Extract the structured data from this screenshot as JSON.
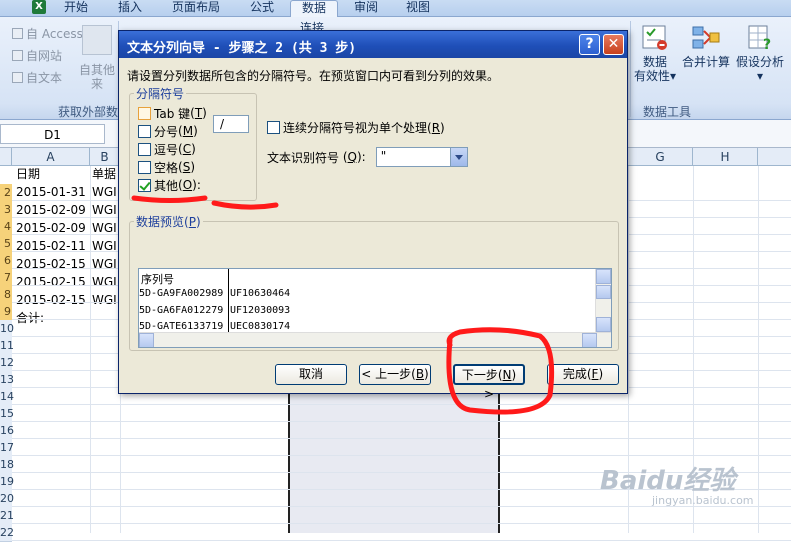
{
  "ribbon": {
    "tabs": [
      "开始",
      "插入",
      "页面布局",
      "公式",
      "数据",
      "审阅",
      "视图"
    ],
    "active_tab": "数据",
    "get_external": [
      "自 Access",
      "自网站",
      "自文本"
    ],
    "other_sources": "自其他来",
    "get_external_group": "获取外部数",
    "connections_partial": "连接",
    "data_tools_items": [
      "数据",
      "合并计算",
      "假设分析"
    ],
    "validity": "有效性",
    "validity_arrow": "▾",
    "whatif_arrow": "▾",
    "data_tools_group": "数据工具"
  },
  "formula_bar": {
    "name_box": "D1"
  },
  "grid": {
    "columns": [
      "A",
      "B",
      "G",
      "H"
    ],
    "rows": [
      "2",
      "3",
      "4",
      "5",
      "6",
      "7",
      "8",
      "9",
      "10",
      "11",
      "12",
      "13",
      "14",
      "15",
      "16",
      "17",
      "18",
      "19",
      "20",
      "21",
      "22"
    ],
    "header_row": [
      "日期",
      "单据"
    ],
    "dates": [
      "2015-01-31",
      "2015-02-09",
      "2015-02-09",
      "2015-02-11",
      "2015-02-15",
      "2015-02-15",
      "2015-02-15"
    ],
    "codes": [
      "WGI",
      "WGI",
      "WGI",
      "WGI",
      "WGI",
      "WGI",
      "WGI"
    ],
    "total_label": "合计:"
  },
  "dialog": {
    "title": "文本分列向导 - 步骤之 2 (共 3 步)",
    "help_glyph": "?",
    "close_glyph": "✕",
    "description": "请设置分列数据所包含的分隔符号。在预览窗口内可看到分列的效果。",
    "delimiter_group": "分隔符号",
    "delimiters": [
      {
        "label": "Tab 键",
        "key": "T",
        "checked": false
      },
      {
        "label": "分号",
        "key": "M",
        "checked": false
      },
      {
        "label": "逗号",
        "key": "C",
        "checked": false
      },
      {
        "label": "空格",
        "key": "S",
        "checked": false
      },
      {
        "label": "其他",
        "key": "O",
        "checked": true
      }
    ],
    "other_value": "/",
    "consecutive_label": "连续分隔符号视为单个处理",
    "consecutive_key": "R",
    "qualifier_label": "文本识别符号",
    "qualifier_key": "Q",
    "qualifier_value": "\"",
    "preview_label": "数据预览",
    "preview_key": "P",
    "preview_rows": [
      [
        "序列号",
        ""
      ],
      [
        "5D-GA9FA002989",
        "UF10630464"
      ],
      [
        "5D-GA6FA012279",
        "UF12030093"
      ],
      [
        "5D-GATE6133719",
        "UEC0830174"
      ]
    ],
    "buttons": {
      "cancel": "取消",
      "back": "< 上一步",
      "back_key": "B",
      "next": "下一步",
      "next_key": "N",
      "next_suffix": ">",
      "finish": "完成",
      "finish_key": "F"
    }
  },
  "watermark": {
    "text": "Baidu经验",
    "sub": "jingyan.baidu.com"
  },
  "colors": {
    "annotation": "#ff1a1a",
    "title_bar": "#1f4fb8",
    "dialog_bg": "#ece9d8"
  }
}
